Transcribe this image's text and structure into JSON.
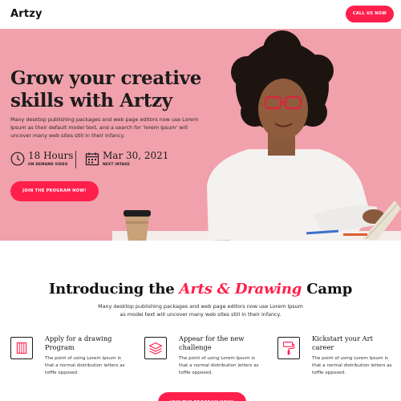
{
  "header": {
    "logo": "Artzy",
    "call_label": "CALL US NOW"
  },
  "hero": {
    "title_line1": "Grow your creative",
    "title_line2": "skills with Artzy",
    "description": "Many desktop publishing packages and web page editors now use Lorem Ipsum as their default model text, and a search for 'lorem ipsum' will uncover many web sites still in their infancy.",
    "stats": [
      {
        "value": "18 Hours",
        "label": "ON DEMAND VIDEO",
        "icon": "clock-icon"
      },
      {
        "value": "Mar 30, 2021",
        "label": "NEXT INTAKE",
        "icon": "calendar-icon"
      }
    ],
    "join_label": "JOIN THE PROGRAM NOW!"
  },
  "intro": {
    "title_pre": "Introducing the ",
    "title_accent": "Arts & Drawing",
    "title_post": " Camp",
    "description": "Many desktop publishing packages and web page editors now use Lorem Ipsum as model text will uncover many web sites still in their infancy."
  },
  "features": [
    {
      "title": "Apply for a drawing Program",
      "text": "The point of using Lorem Ipsum is that a normal distribution letters as toffle opposed.",
      "icon": "drawing-program-icon"
    },
    {
      "title": "Appear for the new challenge",
      "text": "The point of using Lorem Ipsum is that a normal distribution letters as toffle opposed.",
      "icon": "layers-icon"
    },
    {
      "title": "Kickstart your Art career",
      "text": "The point of using Lorem Ipsum is that a normal distribution letters as toffle opposed.",
      "icon": "paint-roller-icon"
    }
  ],
  "bottom": {
    "button_label": "JOIN THE PROGRAM NOW!"
  },
  "colors": {
    "accent": "#ff1f4b",
    "hero_bg": "#f1a1ac",
    "text": "#111111"
  }
}
